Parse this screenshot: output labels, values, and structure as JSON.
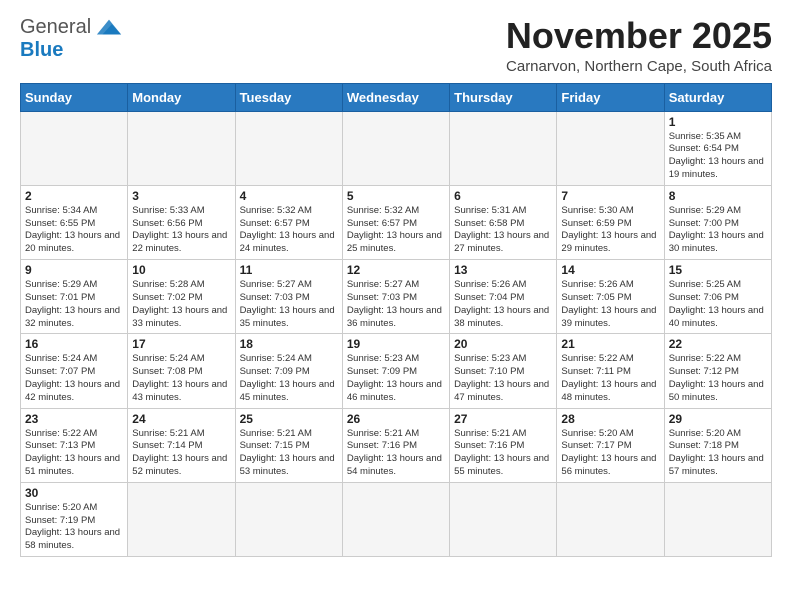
{
  "logo": {
    "general": "General",
    "blue": "Blue"
  },
  "title": {
    "month_year": "November 2025",
    "location": "Carnarvon, Northern Cape, South Africa"
  },
  "weekdays": [
    "Sunday",
    "Monday",
    "Tuesday",
    "Wednesday",
    "Thursday",
    "Friday",
    "Saturday"
  ],
  "days": [
    {
      "date": "",
      "info": ""
    },
    {
      "date": "",
      "info": ""
    },
    {
      "date": "",
      "info": ""
    },
    {
      "date": "",
      "info": ""
    },
    {
      "date": "",
      "info": ""
    },
    {
      "date": "",
      "info": ""
    },
    {
      "date": "1",
      "info": "Sunrise: 5:35 AM\nSunset: 6:54 PM\nDaylight: 13 hours and 19 minutes."
    },
    {
      "date": "2",
      "info": "Sunrise: 5:34 AM\nSunset: 6:55 PM\nDaylight: 13 hours and 20 minutes."
    },
    {
      "date": "3",
      "info": "Sunrise: 5:33 AM\nSunset: 6:56 PM\nDaylight: 13 hours and 22 minutes."
    },
    {
      "date": "4",
      "info": "Sunrise: 5:32 AM\nSunset: 6:57 PM\nDaylight: 13 hours and 24 minutes."
    },
    {
      "date": "5",
      "info": "Sunrise: 5:32 AM\nSunset: 6:57 PM\nDaylight: 13 hours and 25 minutes."
    },
    {
      "date": "6",
      "info": "Sunrise: 5:31 AM\nSunset: 6:58 PM\nDaylight: 13 hours and 27 minutes."
    },
    {
      "date": "7",
      "info": "Sunrise: 5:30 AM\nSunset: 6:59 PM\nDaylight: 13 hours and 29 minutes."
    },
    {
      "date": "8",
      "info": "Sunrise: 5:29 AM\nSunset: 7:00 PM\nDaylight: 13 hours and 30 minutes."
    },
    {
      "date": "9",
      "info": "Sunrise: 5:29 AM\nSunset: 7:01 PM\nDaylight: 13 hours and 32 minutes."
    },
    {
      "date": "10",
      "info": "Sunrise: 5:28 AM\nSunset: 7:02 PM\nDaylight: 13 hours and 33 minutes."
    },
    {
      "date": "11",
      "info": "Sunrise: 5:27 AM\nSunset: 7:03 PM\nDaylight: 13 hours and 35 minutes."
    },
    {
      "date": "12",
      "info": "Sunrise: 5:27 AM\nSunset: 7:03 PM\nDaylight: 13 hours and 36 minutes."
    },
    {
      "date": "13",
      "info": "Sunrise: 5:26 AM\nSunset: 7:04 PM\nDaylight: 13 hours and 38 minutes."
    },
    {
      "date": "14",
      "info": "Sunrise: 5:26 AM\nSunset: 7:05 PM\nDaylight: 13 hours and 39 minutes."
    },
    {
      "date": "15",
      "info": "Sunrise: 5:25 AM\nSunset: 7:06 PM\nDaylight: 13 hours and 40 minutes."
    },
    {
      "date": "16",
      "info": "Sunrise: 5:24 AM\nSunset: 7:07 PM\nDaylight: 13 hours and 42 minutes."
    },
    {
      "date": "17",
      "info": "Sunrise: 5:24 AM\nSunset: 7:08 PM\nDaylight: 13 hours and 43 minutes."
    },
    {
      "date": "18",
      "info": "Sunrise: 5:24 AM\nSunset: 7:09 PM\nDaylight: 13 hours and 45 minutes."
    },
    {
      "date": "19",
      "info": "Sunrise: 5:23 AM\nSunset: 7:09 PM\nDaylight: 13 hours and 46 minutes."
    },
    {
      "date": "20",
      "info": "Sunrise: 5:23 AM\nSunset: 7:10 PM\nDaylight: 13 hours and 47 minutes."
    },
    {
      "date": "21",
      "info": "Sunrise: 5:22 AM\nSunset: 7:11 PM\nDaylight: 13 hours and 48 minutes."
    },
    {
      "date": "22",
      "info": "Sunrise: 5:22 AM\nSunset: 7:12 PM\nDaylight: 13 hours and 50 minutes."
    },
    {
      "date": "23",
      "info": "Sunrise: 5:22 AM\nSunset: 7:13 PM\nDaylight: 13 hours and 51 minutes."
    },
    {
      "date": "24",
      "info": "Sunrise: 5:21 AM\nSunset: 7:14 PM\nDaylight: 13 hours and 52 minutes."
    },
    {
      "date": "25",
      "info": "Sunrise: 5:21 AM\nSunset: 7:15 PM\nDaylight: 13 hours and 53 minutes."
    },
    {
      "date": "26",
      "info": "Sunrise: 5:21 AM\nSunset: 7:16 PM\nDaylight: 13 hours and 54 minutes."
    },
    {
      "date": "27",
      "info": "Sunrise: 5:21 AM\nSunset: 7:16 PM\nDaylight: 13 hours and 55 minutes."
    },
    {
      "date": "28",
      "info": "Sunrise: 5:20 AM\nSunset: 7:17 PM\nDaylight: 13 hours and 56 minutes."
    },
    {
      "date": "29",
      "info": "Sunrise: 5:20 AM\nSunset: 7:18 PM\nDaylight: 13 hours and 57 minutes."
    },
    {
      "date": "30",
      "info": "Sunrise: 5:20 AM\nSunset: 7:19 PM\nDaylight: 13 hours and 58 minutes."
    }
  ]
}
